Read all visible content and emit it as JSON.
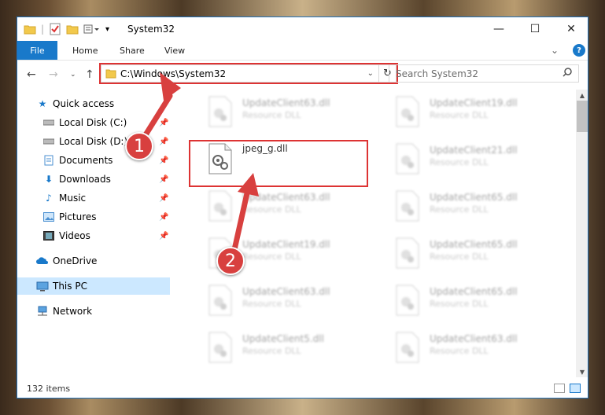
{
  "window": {
    "title": "System32",
    "controls": {
      "minimize": "—",
      "maximize": "☐",
      "close": "✕"
    }
  },
  "ribbon": {
    "tabs": [
      "File",
      "Home",
      "Share",
      "View"
    ],
    "help": "?"
  },
  "address": {
    "path": "C:\\Windows\\System32",
    "search_placeholder": "Search System32"
  },
  "sidebar": {
    "items": [
      {
        "label": "Quick access",
        "icon": "star-icon",
        "pinned": false
      },
      {
        "label": "Local Disk (C:)",
        "icon": "drive-icon",
        "pinned": true
      },
      {
        "label": "Local Disk (D:)",
        "icon": "drive-icon",
        "pinned": true
      },
      {
        "label": "Documents",
        "icon": "documents-icon",
        "pinned": true
      },
      {
        "label": "Downloads",
        "icon": "download-icon",
        "pinned": true
      },
      {
        "label": "Music",
        "icon": "music-icon",
        "pinned": true
      },
      {
        "label": "Pictures",
        "icon": "pictures-icon",
        "pinned": true
      },
      {
        "label": "Videos",
        "icon": "videos-icon",
        "pinned": true
      },
      {
        "label": "OneDrive",
        "icon": "cloud-icon",
        "pinned": false
      },
      {
        "label": "This PC",
        "icon": "computer-icon",
        "pinned": false,
        "selected": true
      },
      {
        "label": "Network",
        "icon": "network-icon",
        "pinned": false
      }
    ]
  },
  "files": [
    {
      "name": "UpdateClient63.dll",
      "desc": "Resource DLL"
    },
    {
      "name": "UpdateClient19.dll",
      "desc": "Resource DLL"
    },
    {
      "name": "jpeg_g.dll",
      "desc": ""
    },
    {
      "name": "UpdateClient21.dll",
      "desc": "Resource DLL"
    },
    {
      "name": "UpdateClient63.dll",
      "desc": "Resource DLL"
    },
    {
      "name": "UpdateClient65.dll",
      "desc": "Resource DLL"
    },
    {
      "name": "UpdateClient19.dll",
      "desc": "Resource DLL"
    },
    {
      "name": "UpdateClient65.dll",
      "desc": "Resource DLL"
    },
    {
      "name": "UpdateClient63.dll",
      "desc": "Resource DLL"
    },
    {
      "name": "UpdateClient65.dll",
      "desc": "Resource DLL"
    },
    {
      "name": "UpdateClient5.dll",
      "desc": "Resource DLL"
    },
    {
      "name": "UpdateClient63.dll",
      "desc": "Resource DLL"
    }
  ],
  "status": {
    "item_count": "132 items"
  },
  "annotations": {
    "step1": "1",
    "step2": "2"
  },
  "colors": {
    "accent": "#1979ca",
    "highlight": "#dd3333",
    "selected": "#cce8ff"
  }
}
